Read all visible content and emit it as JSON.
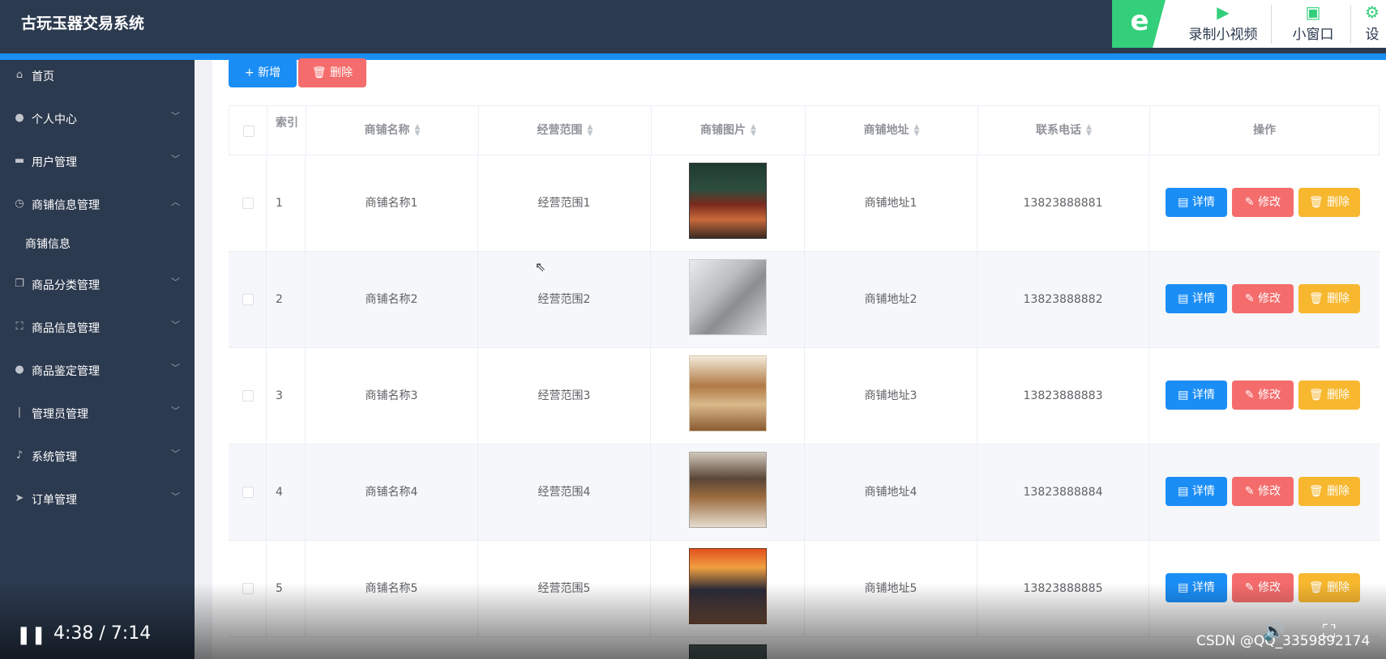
{
  "header": {
    "title": "古玩玉器交易系统"
  },
  "toolbar": {
    "logo": "e",
    "record_label": "录制小视频",
    "mini_label": "小窗口",
    "settings_label": "设"
  },
  "sidebar": {
    "items": [
      {
        "label": "首页",
        "icon": "home-icon",
        "glyph": "⌂"
      },
      {
        "label": "个人中心",
        "icon": "user-icon",
        "glyph": "●"
      },
      {
        "label": "用户管理",
        "icon": "ticket-icon",
        "glyph": "▬"
      },
      {
        "label": "商铺信息管理",
        "icon": "clock-icon",
        "glyph": "◷"
      },
      {
        "label": "商品分类管理",
        "icon": "copy-icon",
        "glyph": "❐"
      },
      {
        "label": "商品信息管理",
        "icon": "frame-icon",
        "glyph": "⛶"
      },
      {
        "label": "商品鉴定管理",
        "icon": "user-icon",
        "glyph": "●"
      },
      {
        "label": "管理员管理",
        "icon": "bulb-icon",
        "glyph": "❘"
      },
      {
        "label": "系统管理",
        "icon": "mic-icon",
        "glyph": "♪"
      },
      {
        "label": "订单管理",
        "icon": "send-icon",
        "glyph": "➤"
      }
    ],
    "sub_item": "商铺信息"
  },
  "actions": {
    "add_label": "+ 新增",
    "delete_label": "删除"
  },
  "table": {
    "columns": {
      "index": "索引",
      "name": "商铺名称",
      "scope": "经营范围",
      "image": "商铺图片",
      "address": "商铺地址",
      "phone": "联系电话",
      "ops": "操作"
    },
    "row_buttons": {
      "detail": "详情",
      "edit": "修改",
      "remove": "删除"
    },
    "rows": [
      {
        "index": "1",
        "name": "商铺名称1",
        "scope": "经营范围1",
        "address": "商铺地址1",
        "phone": "13823888881"
      },
      {
        "index": "2",
        "name": "商铺名称2",
        "scope": "经营范围2",
        "address": "商铺地址2",
        "phone": "13823888882"
      },
      {
        "index": "3",
        "name": "商铺名称3",
        "scope": "经营范围3",
        "address": "商铺地址3",
        "phone": "13823888883"
      },
      {
        "index": "4",
        "name": "商铺名称4",
        "scope": "经营范围4",
        "address": "商铺地址4",
        "phone": "13823888884"
      },
      {
        "index": "5",
        "name": "商铺名称5",
        "scope": "经营范围5",
        "address": "商铺地址5",
        "phone": "13823888885"
      }
    ]
  },
  "video": {
    "time": "4:38 / 7:14",
    "watermark": "CSDN @QQ_3359892174"
  },
  "colors": {
    "header_bg": "#2c3a4f",
    "accent_blue": "#1b8ef6",
    "danger": "#f56c6c",
    "warning": "#f7b830",
    "toolbar_green": "#33cf7b"
  }
}
